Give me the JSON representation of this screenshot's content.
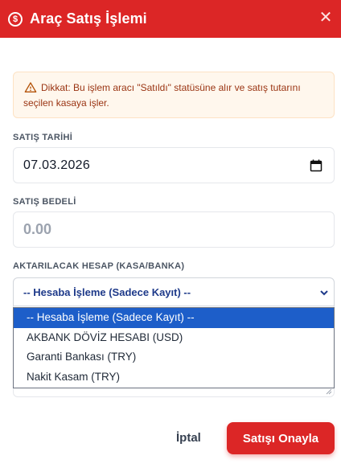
{
  "modal": {
    "title": "Araç Satış İşlemi",
    "close_icon": "close-icon",
    "header_icon": "dollar-circle-icon",
    "accent_color": "#dc2626"
  },
  "alert": {
    "icon": "warning-triangle-icon",
    "line1": "Dikkat: Bu işlem aracı \"Satıldı\" statüsüne alır ve satış tutarını",
    "line2": "seçilen kasaya işler."
  },
  "fields": {
    "date_label": "SATIŞ TARİHİ",
    "date_value": "07.03.2026",
    "price_label": "SATIŞ BEDELİ",
    "price_placeholder": "0.00",
    "account_label": "AKTARILACAK HESAP (KASA/BANKA)",
    "account_selected": "-- Hesaba İşleme (Sadece Kayıt) --"
  },
  "dropdown": {
    "options": [
      "-- Hesaba İşleme (Sadece Kayıt) --",
      "AKBANK DÖVİZ HESABI (USD)",
      "Garanti Bankası (TRY)",
      "Nakit Kasam (TRY)"
    ],
    "selected_index": 0,
    "highlight_color": "#1d5ec9"
  },
  "actions": {
    "cancel_label": "İptal",
    "confirm_label": "Satışı Onayla"
  }
}
